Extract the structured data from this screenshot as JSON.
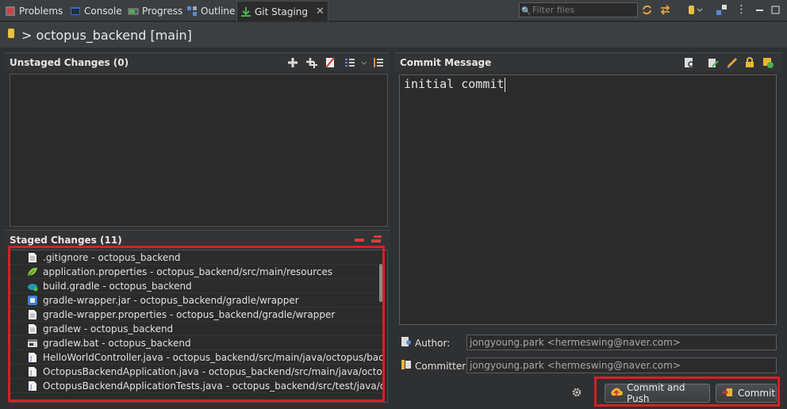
{
  "tabs": [
    {
      "label": "Problems",
      "icon": "problems-icon"
    },
    {
      "label": "Console",
      "icon": "console-icon"
    },
    {
      "label": "Progress",
      "icon": "progress-icon"
    },
    {
      "label": "Outline",
      "icon": "outline-icon"
    },
    {
      "label": "Git Staging",
      "icon": "git-staging-icon",
      "active": true
    }
  ],
  "filter": {
    "placeholder": "Filter files"
  },
  "repo": {
    "title": "> octopus_backend [main]"
  },
  "unstaged": {
    "title": "Unstaged Changes (0)"
  },
  "staged": {
    "title": "Staged Changes (11)",
    "files": [
      {
        "label": ".gitignore - octopus_backend",
        "icon": "text-file-icon"
      },
      {
        "label": "application.properties - octopus_backend/src/main/resources",
        "icon": "spring-properties-icon"
      },
      {
        "label": "build.gradle - octopus_backend",
        "icon": "gradle-icon"
      },
      {
        "label": "gradle-wrapper.jar - octopus_backend/gradle/wrapper",
        "icon": "jar-icon"
      },
      {
        "label": "gradle-wrapper.properties - octopus_backend/gradle/wrapper",
        "icon": "text-file-icon"
      },
      {
        "label": "gradlew - octopus_backend",
        "icon": "text-file-icon"
      },
      {
        "label": "gradlew.bat - octopus_backend",
        "icon": "bat-file-icon"
      },
      {
        "label": "HelloWorldController.java - octopus_backend/src/main/java/octopus/backend",
        "icon": "java-file-icon"
      },
      {
        "label": "OctopusBackendApplication.java - octopus_backend/src/main/java/octopus/b",
        "icon": "java-file-icon"
      },
      {
        "label": "OctopusBackendApplicationTests.java - octopus_backend/src/test/java/octopu",
        "icon": "java-file-icon"
      }
    ]
  },
  "commit": {
    "title": "Commit Message",
    "message": "initial commit",
    "author_label": "Author:",
    "author_value": "jongyoung.park <hermeswing@naver.com>",
    "committer_label": "Committer:",
    "committer_value": "jongyoung.park <hermeswing@naver.com>",
    "commit_and_push_label": "Commit and Push",
    "commit_label": "Commit"
  },
  "colors": {
    "highlight": "#d71f26",
    "background": "#2b2b2b"
  }
}
